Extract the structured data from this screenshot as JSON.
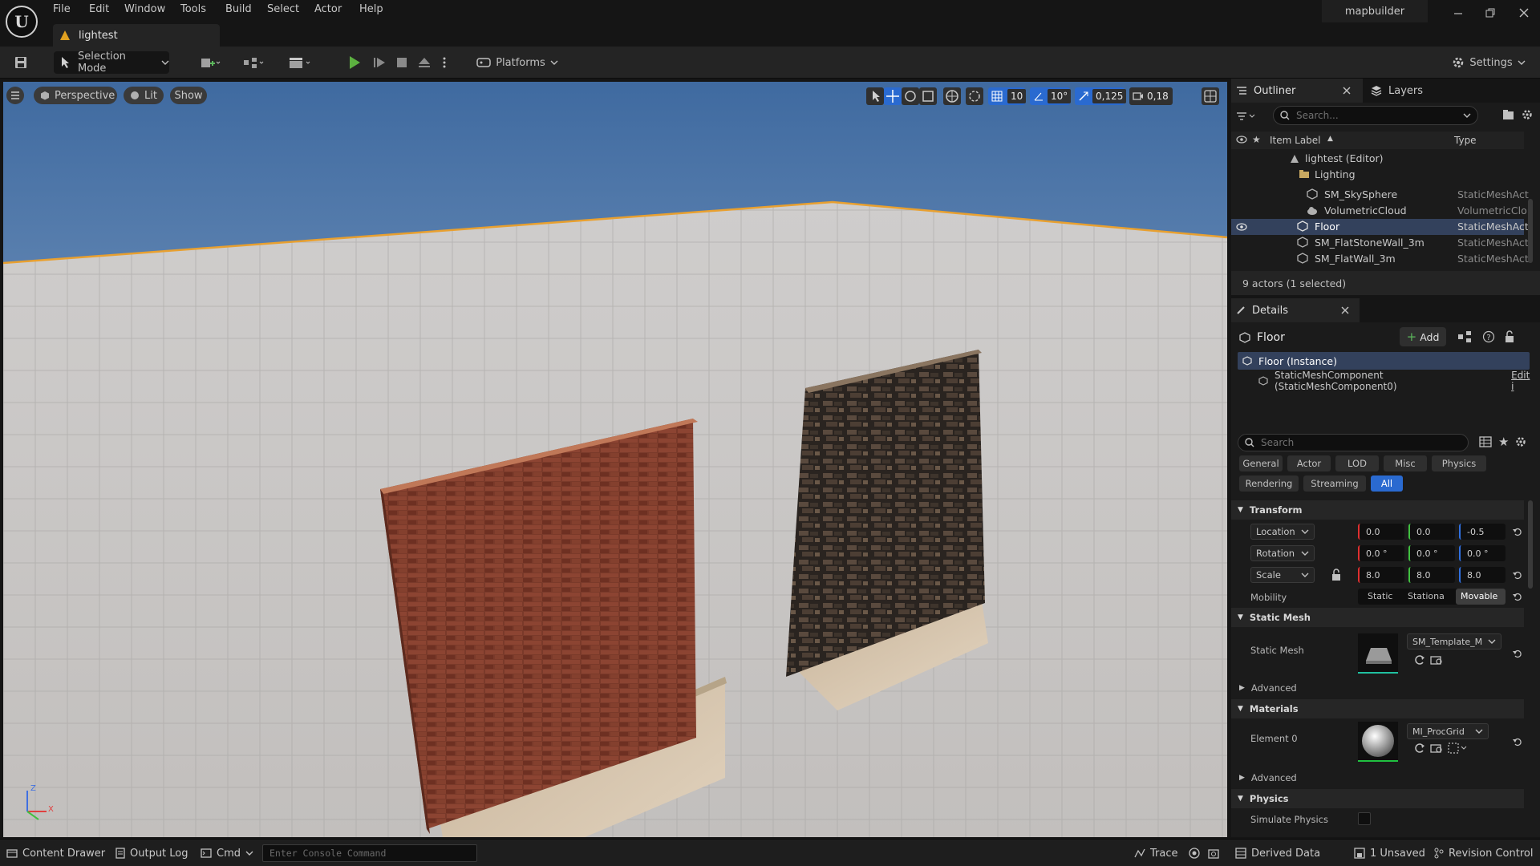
{
  "app": {
    "project_name": "mapbuilder",
    "level_tab": "lightest"
  },
  "menu": [
    "File",
    "Edit",
    "Window",
    "Tools",
    "Build",
    "Select",
    "Actor",
    "Help"
  ],
  "toolbar": {
    "selection_mode": "Selection Mode",
    "platforms": "Platforms",
    "settings": "Settings"
  },
  "viewport": {
    "perspective": "Perspective",
    "lit": "Lit",
    "show": "Show",
    "grid_snap": "10",
    "rotation_snap": "10°",
    "scale_snap": "0,125",
    "camera_speed": "0,18",
    "axis_x": "X",
    "axis_z": "Z"
  },
  "outliner": {
    "tab": "Outliner",
    "layers_tab": "Layers",
    "search_placeholder": "Search...",
    "col_label": "Item Label",
    "col_type": "Type",
    "items": [
      {
        "label": "lightest (Editor)",
        "type": ""
      },
      {
        "label": "Lighting",
        "type": ""
      },
      {
        "label": "SM_SkySphere",
        "type": "StaticMeshAct"
      },
      {
        "label": "VolumetricCloud",
        "type": "VolumetricClo"
      },
      {
        "label": "Floor",
        "type": "StaticMeshAct"
      },
      {
        "label": "SM_FlatStoneWall_3m",
        "type": "StaticMeshAct"
      },
      {
        "label": "SM_FlatWall_3m",
        "type": "StaticMeshAct"
      }
    ],
    "footer": "9 actors (1 selected)"
  },
  "details": {
    "tab": "Details",
    "actor": "Floor",
    "add": "Add",
    "instance": "Floor (Instance)",
    "component": "StaticMeshComponent (StaticMeshComponent0)",
    "edit": "Edit i",
    "search_placeholder": "Search",
    "categories": [
      "General",
      "Actor",
      "LOD",
      "Misc",
      "Physics",
      "Rendering",
      "Streaming",
      "All"
    ],
    "transform": "Transform",
    "location": {
      "label": "Location",
      "x": "0.0",
      "y": "0.0",
      "z": "-0.5"
    },
    "rotation": {
      "label": "Rotation",
      "x": "0.0 °",
      "y": "0.0 °",
      "z": "0.0 °"
    },
    "scale": {
      "label": "Scale",
      "x": "8.0",
      "y": "8.0",
      "z": "8.0"
    },
    "mobility": {
      "label": "Mobility",
      "static": "Static",
      "stationary": "Stationa",
      "movable": "Movable"
    },
    "static_mesh_section": "Static Mesh",
    "static_mesh_label": "Static Mesh",
    "static_mesh_value": "SM_Template_M",
    "advanced": "Advanced",
    "materials_section": "Materials",
    "element0": "Element 0",
    "material_value": "MI_ProcGrid",
    "physics_section": "Physics",
    "simulate_physics": "Simulate Physics"
  },
  "statusbar": {
    "content_drawer": "Content Drawer",
    "output_log": "Output Log",
    "cmd": "Cmd",
    "console_placeholder": "Enter Console Command",
    "trace": "Trace",
    "derived_data": "Derived Data",
    "unsaved": "1 Unsaved",
    "revision_control": "Revision Control"
  }
}
